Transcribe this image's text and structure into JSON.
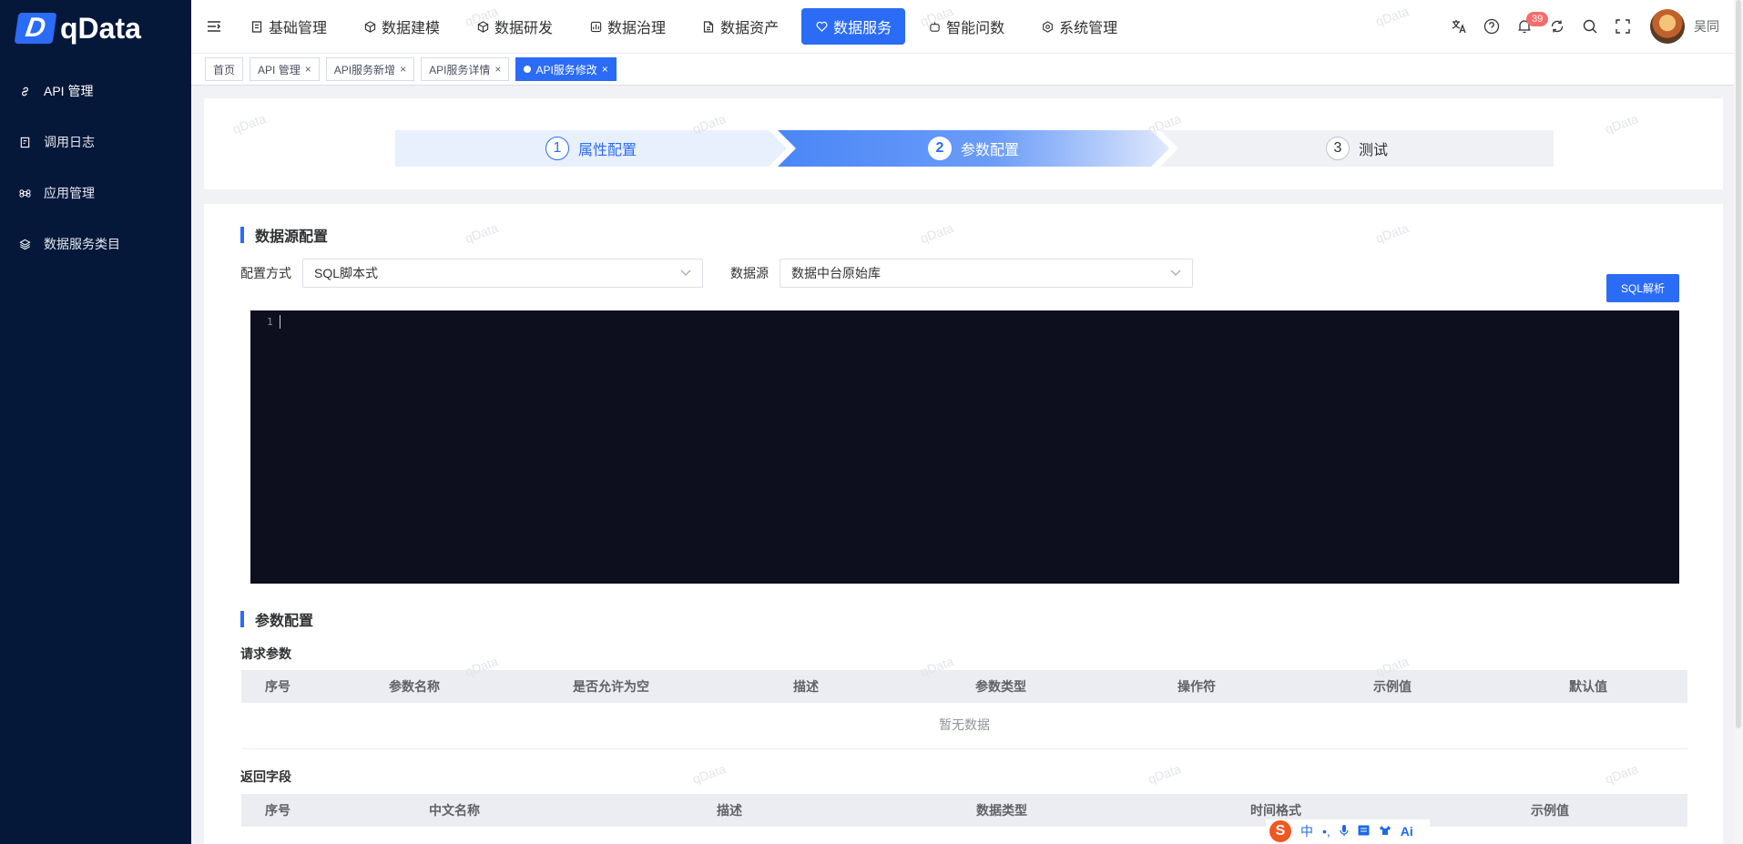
{
  "app": {
    "logo_letter": "D",
    "name": "qData"
  },
  "sidebar": {
    "items": [
      {
        "label": "API 管理",
        "icon": "link-icon"
      },
      {
        "label": "调用日志",
        "icon": "log-icon"
      },
      {
        "label": "应用管理",
        "icon": "command-icon"
      },
      {
        "label": "数据服务类目",
        "icon": "layers-icon"
      }
    ]
  },
  "topnav": {
    "items": [
      {
        "label": "基础管理"
      },
      {
        "label": "数据建模"
      },
      {
        "label": "数据研发"
      },
      {
        "label": "数据治理"
      },
      {
        "label": "数据资产"
      },
      {
        "label": "数据服务"
      },
      {
        "label": "智能问数"
      },
      {
        "label": "系统管理"
      }
    ],
    "notification_count": "39",
    "username": "吴同"
  },
  "tabs": [
    {
      "label": "首页"
    },
    {
      "label": "API 管理"
    },
    {
      "label": "API服务新增"
    },
    {
      "label": "API服务详情"
    },
    {
      "label": "API服务修改"
    }
  ],
  "steps": [
    {
      "num": "1",
      "label": "属性配置"
    },
    {
      "num": "2",
      "label": "参数配置"
    },
    {
      "num": "3",
      "label": "测试"
    }
  ],
  "datasource": {
    "title": "数据源配置",
    "mode_label": "配置方式",
    "mode_value": "SQL脚本式",
    "source_label": "数据源",
    "source_value": "数据中台原始库",
    "sql_button": "SQL解析",
    "editor_line": "1"
  },
  "params": {
    "title": "参数配置",
    "request_title": "请求参数",
    "request_columns": [
      "序号",
      "参数名称",
      "是否允许为空",
      "描述",
      "参数类型",
      "操作符",
      "示例值",
      "默认值"
    ],
    "empty_text": "暂无数据",
    "response_title": "返回字段",
    "response_columns": [
      "序号",
      "中文名称",
      "描述",
      "数据类型",
      "时间格式",
      "示例值"
    ]
  },
  "watermark": "qData",
  "ime": {
    "logo": "S",
    "lang": "中",
    "ai": "Ai"
  },
  "colors": {
    "primary": "#2b6cf6",
    "sidebar": "#06183a",
    "editor": "#0d0f1f"
  }
}
